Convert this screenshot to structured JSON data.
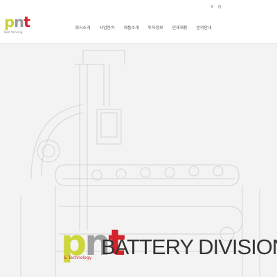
{
  "brand": {
    "logo_text": {
      "p": "p",
      "n": "n",
      "t": "t"
    },
    "tagline": "Best Winning",
    "colors": {
      "lime": "#c8d233",
      "gray": "#999999",
      "red": "#d6242b"
    }
  },
  "utility": {
    "close": "x",
    "lang": "日"
  },
  "nav": {
    "items": [
      {
        "label": "회사소개"
      },
      {
        "label": "사업분야"
      },
      {
        "label": "제품소개"
      },
      {
        "label": "투자정보"
      },
      {
        "label": "인재채용"
      },
      {
        "label": "문의안내"
      }
    ]
  },
  "hero": {
    "logo": {
      "p": "p",
      "n": "n",
      "t": "t",
      "subtitle_pre": "",
      "subtitle_amp": "& Technology"
    },
    "title": "BATTERY DIVISION"
  }
}
